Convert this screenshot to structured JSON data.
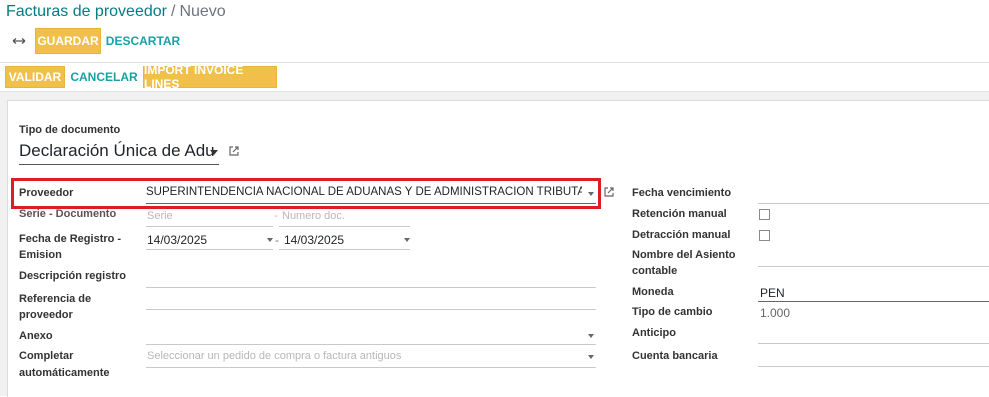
{
  "breadcrumb": {
    "parent": "Facturas de proveedor",
    "separator": "/",
    "current": "Nuevo"
  },
  "toolbar": {
    "save_label": "GUARDAR",
    "discard_label": "DESCARTAR"
  },
  "statusbar": {
    "validate_label": "VALIDAR",
    "cancel_label": "CANCELAR",
    "import_label": "IMPORT INVOICE LINES"
  },
  "form": {
    "doc_type_label": "Tipo de documento",
    "doc_type_value": "Declaración Única de Adu",
    "left": {
      "proveedor_label": "Proveedor",
      "proveedor_value": "SUPERINTENDENCIA NACIONAL DE ADUANAS Y DE ADMINISTRACION TRIBUTARIA - SUI",
      "serie_label": "Serie - Documento",
      "serie_placeholder": "Serie",
      "numero_placeholder": "Numero doc.",
      "dash": "-",
      "fecha_label_1": "Fecha de Registro -",
      "fecha_label_2": "Emision",
      "fecha_registro": "14/03/2025",
      "fecha_emision": "14/03/2025",
      "descripcion_label": "Descripción registro",
      "referencia_label_1": "Referencia de",
      "referencia_label_2": "proveedor",
      "anexo_label": "Anexo",
      "completar_label_1": "Completar",
      "completar_label_2": "automáticamente",
      "completar_placeholder": "Seleccionar un pedido de compra o factura antiguos"
    },
    "right": {
      "vencimiento_label": "Fecha vencimiento",
      "retencion_label": "Retención manual",
      "detraccion_label": "Detracción manual",
      "asiento_label_1": "Nombre del Asiento",
      "asiento_label_2": "contable",
      "moneda_label": "Moneda",
      "moneda_value": "PEN",
      "tipo_cambio_label": "Tipo de cambio",
      "tipo_cambio_value": "1.000",
      "anticipo_label": "Anticipo",
      "cuenta_label": "Cuenta bancaria"
    }
  },
  "colors": {
    "primary": "#f0c04a",
    "link": "#017e84",
    "highlight": "#e01b24"
  },
  "icons": {
    "toggle": "arrows-icon",
    "external": "external-link-icon",
    "dropdown": "caret-down-icon"
  }
}
